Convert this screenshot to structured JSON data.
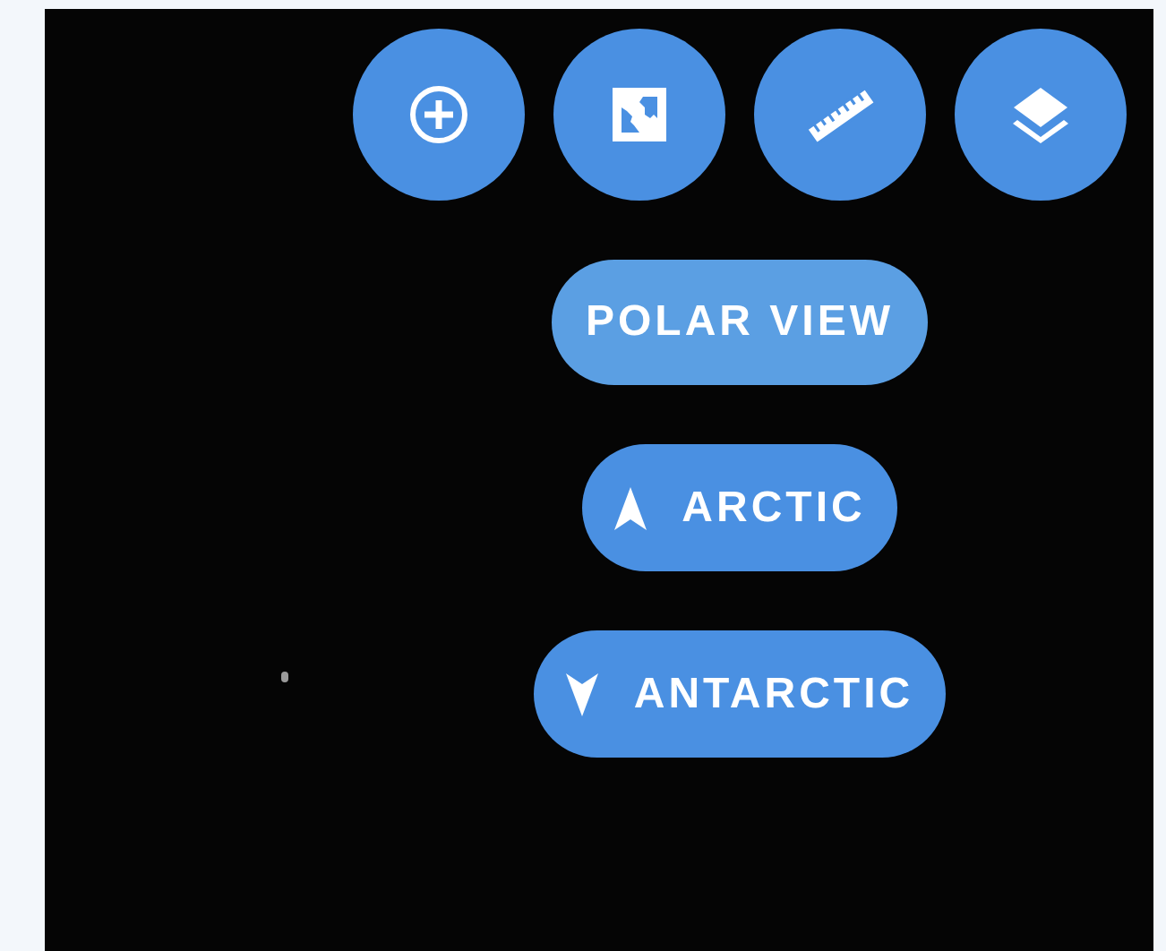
{
  "toolbar": {
    "buttons": [
      {
        "kind": "add"
      },
      {
        "kind": "map"
      },
      {
        "kind": "measure"
      },
      {
        "kind": "layers"
      }
    ]
  },
  "polar_view": {
    "label": "POLAR VIEW",
    "expanded": true,
    "options": [
      {
        "label": "ARCTIC",
        "kind": "north"
      },
      {
        "label": "ANTARCTIC",
        "kind": "south"
      }
    ]
  }
}
